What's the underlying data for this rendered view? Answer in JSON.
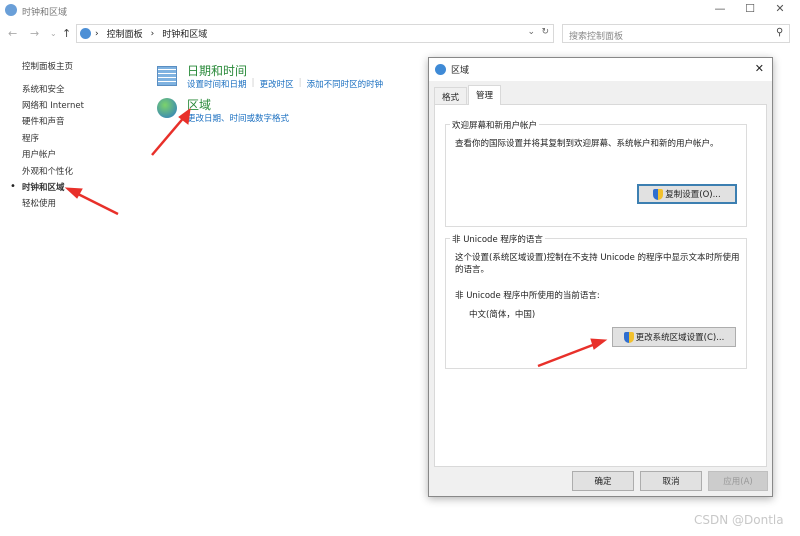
{
  "window": {
    "title": "时钟和区域",
    "minimize": "—",
    "maximize": "☐",
    "close": "✕"
  },
  "address": {
    "breadcrumb": [
      "控制面板",
      "时钟和区域"
    ],
    "search_placeholder": "搜索控制面板"
  },
  "sidebar": {
    "home": "控制面板主页",
    "items": [
      "系统和安全",
      "网络和 Internet",
      "硬件和声音",
      "程序",
      "用户帐户",
      "外观和个性化",
      "时钟和区域",
      "轻松使用"
    ],
    "active_index": 6
  },
  "categories": [
    {
      "title": "日期和时间",
      "links": [
        "设置时间和日期",
        "更改时区",
        "添加不同时区的时钟"
      ],
      "icon": "calendar-clock-icon"
    },
    {
      "title": "区域",
      "links": [
        "更改日期、时间或数字格式"
      ],
      "icon": "globe-clock-icon"
    }
  ],
  "dialog": {
    "title": "区域",
    "close": "✕",
    "tabs": [
      "格式",
      "管理"
    ],
    "active_tab": 1,
    "group1": {
      "title": "欢迎屏幕和新用户帐户",
      "text": "查看你的国际设置并将其复制到欢迎屏幕、系统帐户和新的用户帐户。",
      "button": "复制设置(O)..."
    },
    "group2": {
      "title": "非 Unicode 程序的语言",
      "text": "这个设置(系统区域设置)控制在不支持 Unicode 的程序中显示文本时所使用的语言。",
      "current_label": "非 Unicode 程序中所使用的当前语言:",
      "current_value": "中文(简体，中国)",
      "button": "更改系统区域设置(C)..."
    },
    "ok": "确定",
    "cancel": "取消",
    "apply": "应用(A)"
  },
  "watermark": "CSDN @Dontla",
  "colors": {
    "annotation_arrow": "#e8302a",
    "link": "#1a6fc0",
    "category_title": "#2a8a3a"
  }
}
